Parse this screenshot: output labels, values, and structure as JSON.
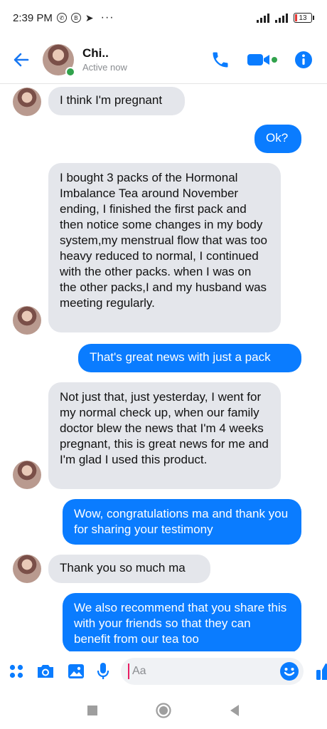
{
  "status_bar": {
    "time": "2:39 PM",
    "dots": "···",
    "battery": "13"
  },
  "header": {
    "contact_name": "Chi..",
    "contact_status": "Active now"
  },
  "messages": [
    {
      "dir": "in",
      "text": "I think I'm pregnant"
    },
    {
      "dir": "out",
      "text": "Ok?"
    },
    {
      "dir": "in",
      "text": "I bought 3 packs of the Hormonal Imbalance Tea around November ending, I finished the first pack and then notice some changes in my body system,my menstrual flow that was too heavy reduced to normal, I continued with the other packs. when I was on the other packs,I and my husband was meeting regularly."
    },
    {
      "dir": "out",
      "text": "That's great news with just a pack"
    },
    {
      "dir": "in",
      "text": "Not just that, just yesterday, I went for my normal check up, when our family doctor blew the news that I'm 4 weeks pregnant, this is  great news for me and I'm glad I used this product."
    },
    {
      "dir": "out",
      "text": "Wow, congratulations ma and thank you for sharing your testimony"
    },
    {
      "dir": "in",
      "text": "Thank you so much ma"
    },
    {
      "dir": "out",
      "text": "We also recommend that you share this with your friends so that they can benefit from our tea too"
    }
  ],
  "composer": {
    "placeholder": "Aa"
  },
  "colors": {
    "accent": "#0a7cff",
    "incoming_bubble": "#e4e6eb",
    "online": "#31a24c"
  },
  "icons": {
    "back": "arrow-left-icon",
    "call": "phone-icon",
    "video": "video-camera-icon",
    "info": "info-icon",
    "apps": "four-dots-icon",
    "camera": "camera-icon",
    "gallery": "image-icon",
    "mic": "microphone-icon",
    "emoji": "smiley-icon",
    "like": "thumbs-up-icon"
  }
}
